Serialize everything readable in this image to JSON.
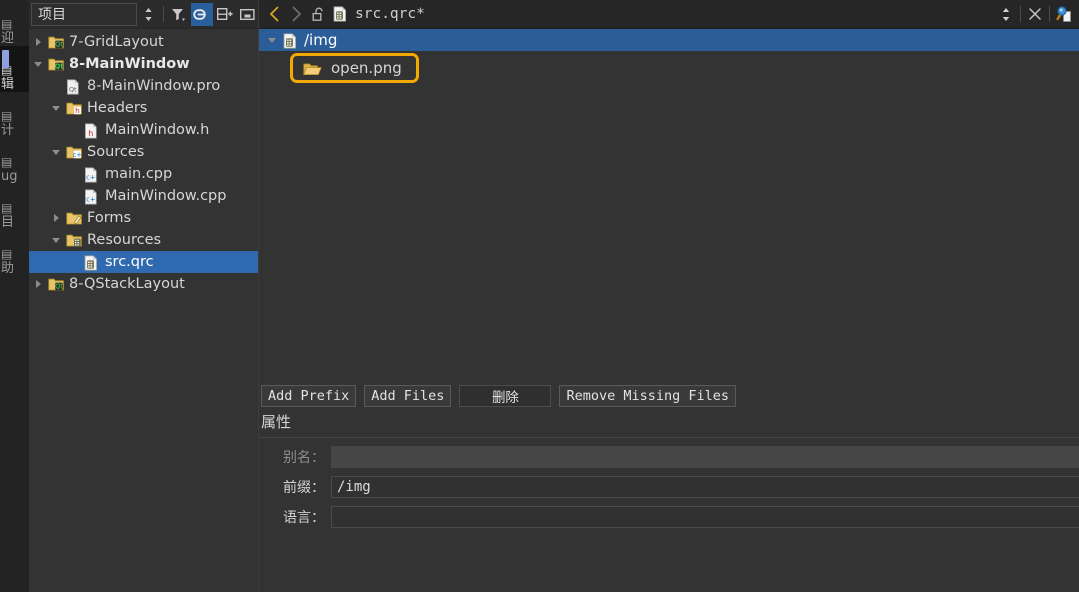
{
  "modebar": {
    "items": [
      {
        "label": "迎",
        "icon": "welcome-icon",
        "active": false
      },
      {
        "label": "辑",
        "icon": "edit-icon",
        "active": true
      },
      {
        "label": "计",
        "icon": "design-icon",
        "active": false
      },
      {
        "label": "ug",
        "icon": "debug-icon",
        "active": false
      },
      {
        "label": "目",
        "icon": "projects-icon",
        "active": false
      },
      {
        "label": "助",
        "icon": "help-icon",
        "active": false
      }
    ]
  },
  "sidebar": {
    "combo_value": "项目",
    "toolbar": [
      {
        "name": "sort-updown-icon",
        "title": "排序",
        "selected": false
      },
      {
        "name": "filter-icon",
        "title": "过滤",
        "selected": false
      },
      {
        "name": "link-sync-icon",
        "title": "同步",
        "selected": true
      },
      {
        "name": "split-add-icon",
        "title": "新建分栏",
        "selected": false
      },
      {
        "name": "collapse-icon",
        "title": "隐藏",
        "selected": false
      }
    ],
    "tree": [
      {
        "label": "7-GridLayout",
        "indent": 0,
        "arrow": "closed",
        "icon": "qt-project-icon",
        "selected": false,
        "bold": false
      },
      {
        "label": "8-MainWindow",
        "indent": 0,
        "arrow": "open",
        "icon": "qt-project-icon",
        "selected": false,
        "bold": true
      },
      {
        "label": "8-MainWindow.pro",
        "indent": 1,
        "arrow": "none",
        "icon": "qt-pro-file-icon",
        "selected": false,
        "bold": false
      },
      {
        "label": "Headers",
        "indent": 1,
        "arrow": "open",
        "icon": "headers-folder-icon",
        "selected": false,
        "bold": false
      },
      {
        "label": "MainWindow.h",
        "indent": 2,
        "arrow": "none",
        "icon": "h-file-icon",
        "selected": false,
        "bold": false
      },
      {
        "label": "Sources",
        "indent": 1,
        "arrow": "open",
        "icon": "sources-folder-icon",
        "selected": false,
        "bold": false
      },
      {
        "label": "main.cpp",
        "indent": 2,
        "arrow": "none",
        "icon": "cpp-file-icon",
        "selected": false,
        "bold": false
      },
      {
        "label": "MainWindow.cpp",
        "indent": 2,
        "arrow": "none",
        "icon": "cpp-file-icon",
        "selected": false,
        "bold": false
      },
      {
        "label": "Forms",
        "indent": 1,
        "arrow": "closed",
        "icon": "forms-folder-icon",
        "selected": false,
        "bold": false
      },
      {
        "label": "Resources",
        "indent": 1,
        "arrow": "open",
        "icon": "resources-folder-icon",
        "selected": false,
        "bold": false
      },
      {
        "label": "src.qrc",
        "indent": 2,
        "arrow": "none",
        "icon": "qrc-file-icon",
        "selected": true,
        "bold": false
      },
      {
        "label": "8-QStackLayout",
        "indent": 0,
        "arrow": "closed",
        "icon": "qt-project-icon",
        "selected": false,
        "bold": false
      }
    ]
  },
  "editor": {
    "nav": {
      "back_icon": "chevron-left-icon",
      "forward_icon": "chevron-right-icon",
      "lock_icon": "unlocked-padlock-icon",
      "file_icon": "qrc-file-icon",
      "filename": "src.qrc*",
      "updown_icon": "updown-arrows-icon",
      "close_icon": "close-x-icon",
      "search_icon": "search-document-icon"
    },
    "resource_tree": {
      "prefix_row": {
        "label": "/img",
        "icon": "qrc-prefix-icon",
        "arrow": "open",
        "selected": true
      },
      "file_row": {
        "label": "open.png",
        "icon": "open-folder-icon",
        "highlighted": true
      }
    },
    "buttons": [
      {
        "label": "Add Prefix",
        "name": "add-prefix-button",
        "dim": false
      },
      {
        "label": "Add Files",
        "name": "add-files-button",
        "dim": false
      },
      {
        "label": "删除",
        "name": "remove-button",
        "dim": true
      },
      {
        "label": "Remove Missing Files",
        "name": "remove-missing-files-button",
        "dim": false
      }
    ],
    "properties": {
      "title": "属性",
      "fields": [
        {
          "label": "别名：",
          "value": "",
          "name": "alias-field",
          "disabled": true
        },
        {
          "label": "前缀：",
          "value": "/img",
          "name": "prefix-field",
          "disabled": false
        },
        {
          "label": "语言：",
          "value": "",
          "name": "language-field",
          "disabled": false
        }
      ]
    }
  },
  "colors": {
    "selection_blue": "#2f6ab0",
    "prefix_row_blue": "#2b5e99",
    "highlight_gold": "#f2a900",
    "panel_bg": "#333333",
    "modebar_bg": "#232323",
    "header_bg": "#262626",
    "mode_active_bar": "#8f9fe0"
  }
}
